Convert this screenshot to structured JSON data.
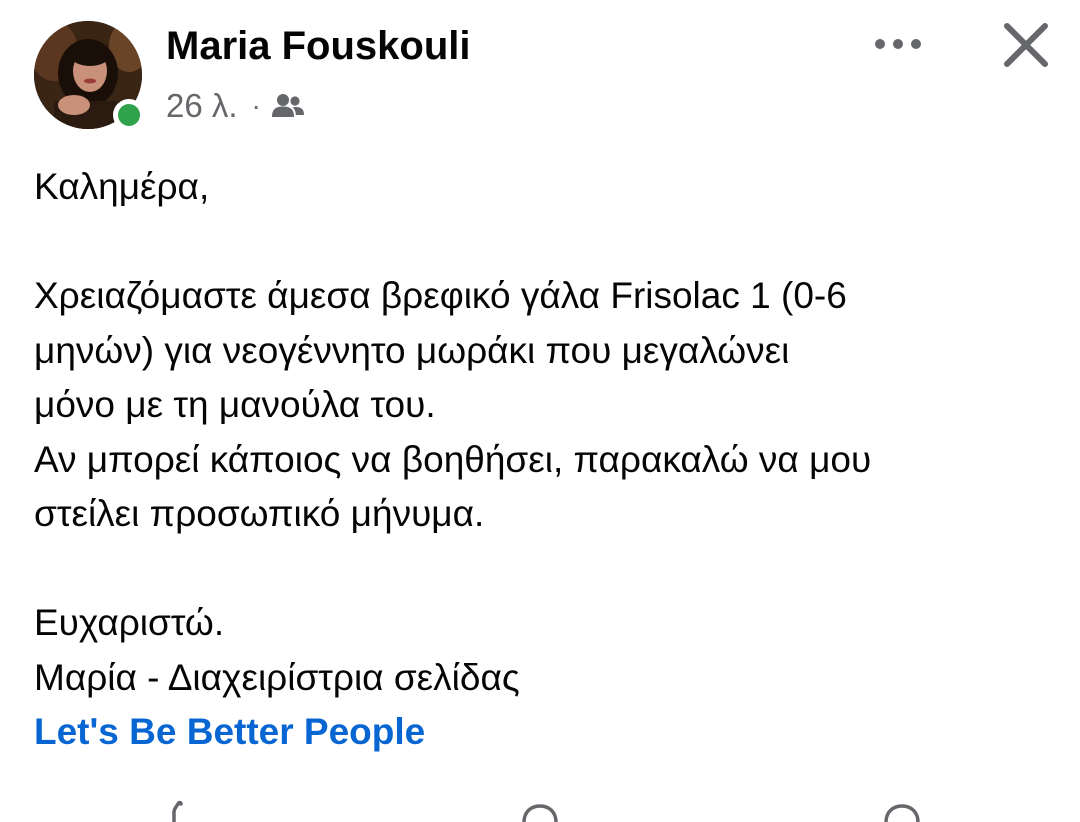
{
  "post": {
    "author": "Maria Fouskouli",
    "time": "26 λ.",
    "separator": "·",
    "audience_icon": "friends-icon",
    "body_lines": [
      "Καλημέρα,",
      "",
      "Χρειαζόμαστε άμεσα βρεφικό γάλα Frisolac 1 (0-6",
      "μηνών) για νεογέννητο μωράκι που μεγαλώνει",
      "μόνο με τη μανούλα του.",
      "Αν μπορεί κάποιος να βοηθήσει, παρακαλώ να μου",
      "στείλει προσωπικό μήνυμα.",
      "",
      "Ευχαριστώ.",
      "Μαρία - Διαχειρίστρια σελίδας"
    ],
    "link_text": "Let's Be Better People"
  },
  "icons": {
    "more": "more-options-icon",
    "close": "close-icon",
    "online": "online-status-icon"
  },
  "colors": {
    "link": "#0866d3",
    "meta": "#65676b",
    "online": "#31a24c",
    "text": "#050505"
  }
}
